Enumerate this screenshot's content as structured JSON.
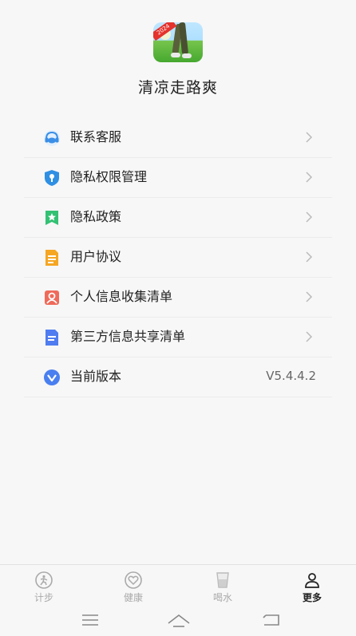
{
  "app": {
    "name": "清凉走路爽",
    "icon_badge": "2024"
  },
  "menu": [
    {
      "label": "联系客服",
      "icon": "headset-icon",
      "color": "#3a8ee6",
      "type": "link"
    },
    {
      "label": "隐私权限管理",
      "icon": "shield-icon",
      "color": "#2f8fe3",
      "type": "link"
    },
    {
      "label": "隐私政策",
      "icon": "bookmark-star-icon",
      "color": "#33c173",
      "type": "link"
    },
    {
      "label": "用户协议",
      "icon": "document-icon",
      "color": "#f5a623",
      "type": "link"
    },
    {
      "label": "个人信息收集清单",
      "icon": "person-card-icon",
      "color": "#ef6a5a",
      "type": "link"
    },
    {
      "label": "第三方信息共享清单",
      "icon": "file-list-icon",
      "color": "#4f7cf0",
      "type": "link"
    },
    {
      "label": "当前版本",
      "icon": "version-icon",
      "color": "#4a7ff0",
      "type": "value",
      "value": "V5.4.4.2"
    }
  ],
  "tabs": [
    {
      "label": "计步",
      "icon": "step-count-icon",
      "active": false
    },
    {
      "label": "健康",
      "icon": "heart-icon",
      "active": false
    },
    {
      "label": "喝水",
      "icon": "water-cup-icon",
      "active": false
    },
    {
      "label": "更多",
      "icon": "person-icon",
      "active": true
    }
  ],
  "nav": [
    "menu-icon",
    "home-icon",
    "back-icon"
  ]
}
